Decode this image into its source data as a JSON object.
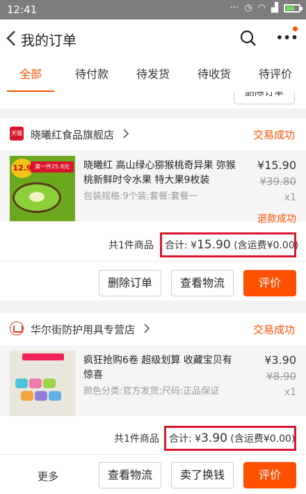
{
  "status_bar": {
    "time": "12:41",
    "icons": [
      "...",
      "alarm-icon",
      "wifi-icon",
      "signal-icon",
      "battery-icon"
    ]
  },
  "header": {
    "title": "我的订单"
  },
  "tabs": [
    {
      "label": "全部",
      "active": true
    },
    {
      "label": "待付款"
    },
    {
      "label": "待发货"
    },
    {
      "label": "待收货"
    },
    {
      "label": "待评价"
    }
  ],
  "peek": {
    "button_label": "删除订单"
  },
  "orders": [
    {
      "shop_name": "晓曦红食品旗舰店",
      "shop_icon_text": "天猫",
      "status": "交易成功",
      "product": {
        "title": "晓曦红 高山绿心猕猴桃奇异果 弥猴桃新鲜时令水果 特大果9枚装",
        "spec": "包装规格:9个装;套餐:套餐一",
        "price": "¥15.90",
        "original_price": "¥39.80",
        "quantity": "x1",
        "badge": "12.9",
        "promo": "第一件25.8元"
      },
      "refund_status": "退款成功",
      "summary": {
        "count": "共1件商品",
        "total_label": "合计: ¥",
        "total": "15.90",
        "shipping": " (含运费¥0.00)"
      },
      "actions": {
        "delete": "删除订单",
        "logistics": "查看物流",
        "review": "评价"
      }
    },
    {
      "shop_name": "华尔街防护用具专营店",
      "status": "交易成功",
      "product": {
        "title": "疯狂抢购6卷 超级划算 收藏宝贝有惊喜",
        "spec": "颜色分类:官方发货;尺码:正品保证",
        "price": "¥3.90",
        "original_price": "¥8.90",
        "quantity": "x1"
      },
      "summary": {
        "count": "共1件商品",
        "total_label": "合计: ¥",
        "total": "3.90",
        "shipping": " (含运费¥0.00)"
      },
      "actions": {
        "more": "更多",
        "logistics": "查看物流",
        "sell": "卖了换钱",
        "review": "评价"
      }
    }
  ],
  "colors": {
    "accent": "#ff5000",
    "tmall_red": "#d8162d",
    "highlight_box": "#d8162d"
  }
}
